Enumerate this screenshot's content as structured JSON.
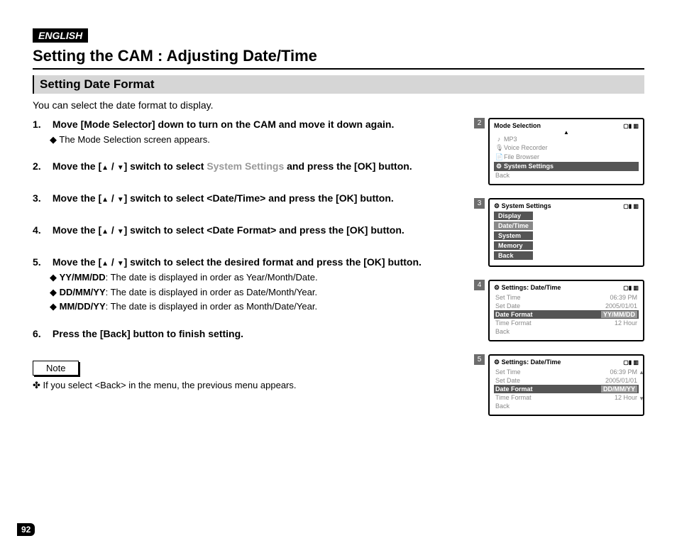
{
  "lang_badge": "ENGLISH",
  "page_title": "Setting the CAM : Adjusting Date/Time",
  "section_title": "Setting Date Format",
  "intro": "You can select the date format to display.",
  "page_number": "92",
  "steps": {
    "s1": {
      "head": "Move [Mode Selector] down to turn on the CAM and move it down again.",
      "sub1": "The Mode Selection screen appears."
    },
    "s2": {
      "pre": "Move the [",
      "post": "] switch to select ",
      "target": "System Settings",
      "tail": " and press the [OK] button."
    },
    "s3": {
      "pre": "Move the [",
      "post": "] switch to select <Date/Time> and press the [OK] button."
    },
    "s4": {
      "pre": "Move the [",
      "post": "] switch to select <Date Format> and press the [OK] button."
    },
    "s5": {
      "pre": "Move the [",
      "post": "] switch to select the desired format and press the [OK] button.",
      "sub1_b": "YY/MM/DD",
      "sub1_t": ": The date is displayed in order as Year/Month/Date.",
      "sub2_b": "DD/MM/YY",
      "sub2_t": ": The date is displayed in order as Date/Month/Year.",
      "sub3_b": "MM/DD/YY",
      "sub3_t": ": The date is displayed in order as Month/Date/Year."
    },
    "s6": {
      "head": "Press the [Back] button to finish setting."
    }
  },
  "note_label": "Note",
  "note_text": "If you select <Back> in the menu, the previous menu appears.",
  "scr2": {
    "tag": "2",
    "title": "Mode Selection",
    "batt": "▢▮ ▥",
    "items": [
      "MP3",
      "Voice Recorder",
      "File Browser",
      "System Settings",
      "Back"
    ],
    "icons": [
      "♪",
      "🎙",
      "📄",
      "⚙",
      ""
    ]
  },
  "scr3": {
    "tag": "3",
    "title": "System Settings",
    "batt": "▢▮ ▥",
    "items": [
      "Display",
      "Date/Time",
      "System",
      "Memory",
      "Back"
    ]
  },
  "scr4": {
    "tag": "4",
    "title": "Settings: Date/Time",
    "batt": "▢▮ ▥",
    "rows": [
      {
        "k": "Set Time",
        "v": "06:39 PM"
      },
      {
        "k": "Set Date",
        "v": "2005/01/01"
      },
      {
        "k": "Date Format",
        "v": "YY/MM/DD",
        "sel": true
      },
      {
        "k": "Time Format",
        "v": "12 Hour"
      },
      {
        "k": "Back",
        "v": ""
      }
    ]
  },
  "scr5": {
    "tag": "5",
    "title": "Settings: Date/Time",
    "batt": "▢▮ ▥",
    "rows": [
      {
        "k": "Set Time",
        "v": "06:39 PM"
      },
      {
        "k": "Set Date",
        "v": "2005/01/01"
      },
      {
        "k": "Date Format",
        "v": "DD/MM/YY",
        "sel": true
      },
      {
        "k": "Time Format",
        "v": "12 Hour"
      },
      {
        "k": "Back",
        "v": ""
      }
    ]
  }
}
